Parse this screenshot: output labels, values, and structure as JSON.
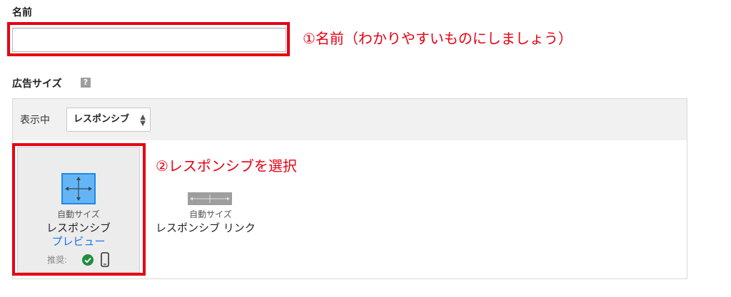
{
  "name_section": {
    "label": "名前",
    "input_value": "",
    "input_placeholder": "",
    "annotation": "①名前（わかりやすいものにしましょう）"
  },
  "size_section": {
    "label": "広告サイズ",
    "help_icon": "?",
    "help_icon_name": "question-mark-icon",
    "showing_label": "表示中",
    "select_value": "レスポンシブ",
    "annotation": "②レスポンシブを選択",
    "cards": [
      {
        "icon": "four-way-arrows-icon",
        "caption": "自動サイズ",
        "title": "レスポンシブ",
        "link": "プレビュー",
        "recommended_label": "推奨:",
        "recommended_icons": [
          "check-circle-icon",
          "mobile-phone-icon"
        ],
        "selected": true
      },
      {
        "icon": "horizontal-arrows-icon",
        "caption": "自動サイズ",
        "title": "レスポンシブ リンク",
        "selected": false
      }
    ]
  },
  "colors": {
    "highlight_red": "#e60012",
    "link_blue": "#1a73e8",
    "selected_icon_blue": "#64b5f6",
    "check_green": "#1e8e3e",
    "panel_header_gray": "#f1f1f1"
  }
}
